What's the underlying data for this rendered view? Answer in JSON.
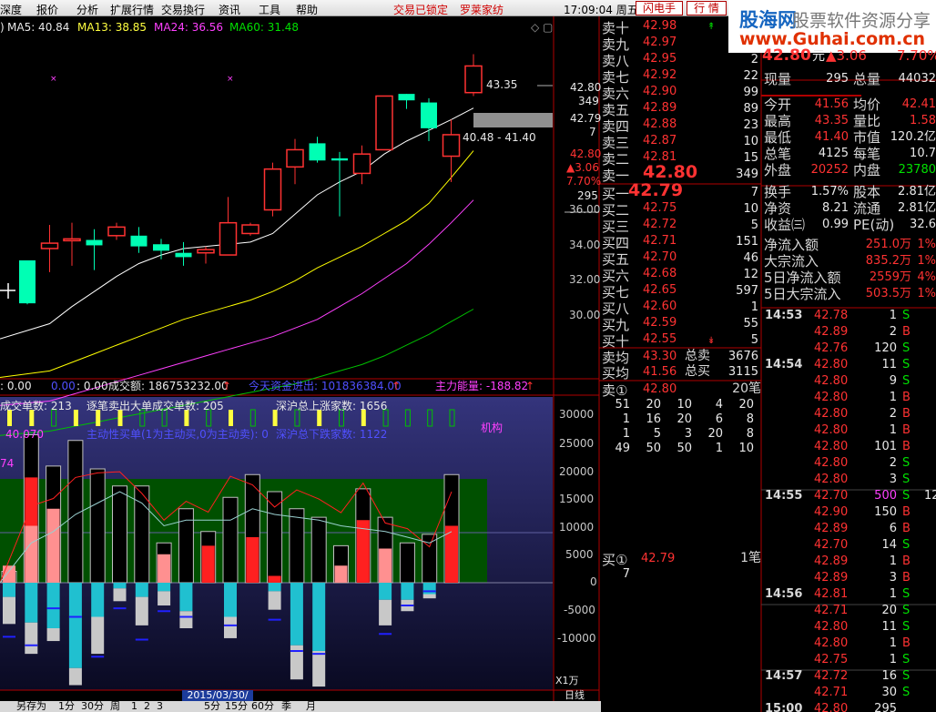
{
  "menu": [
    "深度",
    "报价",
    "分析",
    "扩展行情",
    "交易換行",
    "资讯",
    "工具",
    "帮助"
  ],
  "menu_status": [
    "交易已锁定",
    "罗莱家纺"
  ],
  "clock": "17:09:04 周五",
  "buttons": {
    "flash": "闪电手",
    "market": "行 情"
  },
  "logo": {
    "name": "股海网",
    "tagline": "股票软件资源分享",
    "url": "www.Guhai.com.cn"
  },
  "colors": {
    "up": "#ff3232",
    "down": "#00ffff",
    "ma5": "#ffffff",
    "ma13": "#ffff00",
    "ma24": "#ff40ff",
    "ma60": "#00c000"
  },
  "ma_header": {
    "prefix": ")",
    "ma5": "MA5: 40.84",
    "ma13": "MA13: 38.85",
    "ma24": "MA24: 36.56",
    "ma60": "MA60: 31.48"
  },
  "annotations": {
    "high": "43.35",
    "range": "40.48 - 41.40"
  },
  "price_axis": {
    "ticks": [
      "36.00",
      "34.00",
      "32.00",
      "30.00"
    ],
    "quote": [
      "42.80",
      "349",
      "42.79",
      "7",
      "42.80",
      "▲3.06",
      "7.70%",
      "295"
    ]
  },
  "indicator_header": {
    "a": ": 0.00",
    "b": "0.00",
    "c": ": 0.00",
    "d": "成交额: 186753232.00",
    "e": "今天资金进出: 101836384.00",
    "f": "主力能量: -188.82"
  },
  "indicator_texts": {
    "l1a": "成交单数: 213",
    "l1b": "逐笔卖出大单成交单数: 205",
    "l1c": "深沪总上涨家数: 1656",
    "l2a": "40.070",
    "l2b": "主动性买单(1为主动买,0为主动卖): 0",
    "l2c": "深沪总下跌家数: 1122",
    "l3": "74",
    "jigou": "机构"
  },
  "ind_axis": [
    "30000",
    "25000",
    "20000",
    "15000",
    "10000",
    "5000",
    "0",
    "-5000",
    "-10000"
  ],
  "unit_label": "X1万",
  "daily_label": "日线",
  "date_label": "2015/03/30/一",
  "bottom_tabs": [
    "另存为",
    "1分",
    "30分",
    "周",
    "1",
    "2",
    "3",
    "5分",
    "15分",
    "60分",
    "季",
    "月"
  ],
  "order_book": {
    "asks": [
      {
        "label": "卖十",
        "price": "42.98",
        "vol": ""
      },
      {
        "label": "卖九",
        "price": "42.97",
        "vol": ""
      },
      {
        "label": "卖八",
        "price": "42.95",
        "vol": "2"
      },
      {
        "label": "卖七",
        "price": "42.92",
        "vol": "22"
      },
      {
        "label": "卖六",
        "price": "42.90",
        "vol": "99"
      },
      {
        "label": "卖五",
        "price": "42.89",
        "vol": "89"
      },
      {
        "label": "卖四",
        "price": "42.88",
        "vol": "23"
      },
      {
        "label": "卖三",
        "price": "42.87",
        "vol": "10"
      },
      {
        "label": "卖二",
        "price": "42.81",
        "vol": "15"
      },
      {
        "label": "卖一",
        "price": "42.80",
        "vol": "349"
      }
    ],
    "bids": [
      {
        "label": "买一",
        "price": "42.79",
        "vol": "7"
      },
      {
        "label": "买二",
        "price": "42.75",
        "vol": "10"
      },
      {
        "label": "买三",
        "price": "42.72",
        "vol": "5"
      },
      {
        "label": "买四",
        "price": "42.71",
        "vol": "151"
      },
      {
        "label": "买五",
        "price": "42.70",
        "vol": "46"
      },
      {
        "label": "买六",
        "price": "42.68",
        "vol": "12"
      },
      {
        "label": "买七",
        "price": "42.65",
        "vol": "597"
      },
      {
        "label": "买八",
        "price": "42.60",
        "vol": "1"
      },
      {
        "label": "买九",
        "price": "42.59",
        "vol": "55"
      },
      {
        "label": "买十",
        "price": "42.55",
        "vol": "5"
      }
    ],
    "avg_rows": [
      {
        "label": "卖均",
        "price": "43.30",
        "name": "总卖",
        "vol": "3676"
      },
      {
        "label": "买均",
        "price": "41.56",
        "name": "总买",
        "vol": "3115"
      }
    ],
    "sell1_queue": {
      "label": "卖①",
      "price": "42.80",
      "count": "20笔",
      "rows": [
        [
          "51",
          "20",
          "10",
          "4",
          "20"
        ],
        [
          "1",
          "16",
          "20",
          "6",
          "8"
        ],
        [
          "1",
          "5",
          "3",
          "20",
          "8"
        ],
        [
          "49",
          "50",
          "50",
          "1",
          "10"
        ]
      ]
    },
    "buy1_queue": {
      "label": "买①",
      "price": "42.79",
      "count": "1笔",
      "rows": [
        [
          "7"
        ]
      ]
    }
  },
  "quote_panel": {
    "top": {
      "price": "42.80",
      "unit": "元",
      "change": "▲3.06",
      "pct": "7.70%"
    },
    "rows": [
      [
        "现量",
        "295",
        "总量",
        "44032"
      ],
      [
        "今开",
        "41.56",
        "均价",
        "42.41"
      ],
      [
        "最高",
        "43.35",
        "量比",
        "1.58"
      ],
      [
        "最低",
        "41.40",
        "市值",
        "120.2亿"
      ],
      [
        "总笔",
        "4125",
        "每笔",
        "10.7"
      ],
      [
        "外盘",
        "20252",
        "内盘",
        "23780"
      ],
      [
        "换手",
        "1.57%",
        "股本",
        "2.81亿"
      ],
      [
        "净资",
        "8.21",
        "流通",
        "2.81亿"
      ],
      [
        "收益㈢",
        "0.99",
        "PE(动)",
        "32.6"
      ],
      [
        "净流入额",
        "",
        "251.0万",
        "1%"
      ],
      [
        "大宗流入",
        "",
        "835.2万",
        "1%"
      ],
      [
        "5日净流入额",
        "",
        "2559万",
        "4%"
      ],
      [
        "5日大宗流入",
        "",
        "503.5万",
        "1%"
      ]
    ]
  },
  "ticks": [
    {
      "time": "14:53",
      "price": "42.78",
      "vol": "1",
      "bs": "S"
    },
    {
      "time": "",
      "price": "42.89",
      "vol": "2",
      "bs": "B"
    },
    {
      "time": "",
      "price": "42.76",
      "vol": "120",
      "bs": "S"
    },
    {
      "time": "14:54",
      "price": "42.80",
      "vol": "11",
      "bs": "S"
    },
    {
      "time": "",
      "price": "42.80",
      "vol": "9",
      "bs": "S"
    },
    {
      "time": "",
      "price": "42.80",
      "vol": "1",
      "bs": "B"
    },
    {
      "time": "",
      "price": "42.80",
      "vol": "2",
      "bs": "B"
    },
    {
      "time": "",
      "price": "42.80",
      "vol": "1",
      "bs": "B"
    },
    {
      "time": "",
      "price": "42.80",
      "vol": "101",
      "bs": "B"
    },
    {
      "time": "",
      "price": "42.80",
      "vol": "2",
      "bs": "S"
    },
    {
      "time": "",
      "price": "42.80",
      "vol": "3",
      "bs": "S"
    },
    {
      "time": "14:55",
      "price": "42.70",
      "vol": "500",
      "bs": "S",
      "extra": "12"
    },
    {
      "time": "",
      "price": "42.90",
      "vol": "150",
      "bs": "B"
    },
    {
      "time": "",
      "price": "42.89",
      "vol": "6",
      "bs": "B"
    },
    {
      "time": "",
      "price": "42.70",
      "vol": "14",
      "bs": "S"
    },
    {
      "time": "",
      "price": "42.89",
      "vol": "1",
      "bs": "B"
    },
    {
      "time": "",
      "price": "42.89",
      "vol": "3",
      "bs": "B"
    },
    {
      "time": "14:56",
      "price": "42.81",
      "vol": "1",
      "bs": "S"
    },
    {
      "time": "",
      "price": "42.71",
      "vol": "20",
      "bs": "S"
    },
    {
      "time": "",
      "price": "42.80",
      "vol": "11",
      "bs": "S"
    },
    {
      "time": "",
      "price": "42.80",
      "vol": "1",
      "bs": "B"
    },
    {
      "time": "",
      "price": "42.75",
      "vol": "1",
      "bs": "S"
    },
    {
      "time": "14:57",
      "price": "42.72",
      "vol": "16",
      "bs": "S"
    },
    {
      "time": "",
      "price": "42.71",
      "vol": "30",
      "bs": "S"
    },
    {
      "time": "15:00",
      "price": "42.80",
      "vol": "295",
      "bs": ""
    }
  ],
  "chart_data": [
    {
      "type": "candlestick",
      "title": "",
      "ylabel": "",
      "ylim": [
        29,
        44.6
      ],
      "series": [
        {
          "name": "K",
          "values": [
            {
              "o": 33.75,
              "c": 31.75,
              "h": 33.75,
              "l": 31.7
            },
            {
              "o": 34.3,
              "c": 34.55,
              "h": 35.4,
              "l": 33.2
            },
            {
              "o": 34.7,
              "c": 34.75,
              "h": 35.5,
              "l": 33.5
            },
            {
              "o": 34.7,
              "c": 34.45,
              "h": 35.2,
              "l": 33.3
            },
            {
              "o": 34.9,
              "c": 35.3,
              "h": 35.5,
              "l": 34.7
            },
            {
              "o": 34.9,
              "c": 34.4,
              "h": 35.3,
              "l": 34.1
            },
            {
              "o": 34.5,
              "c": 34.2,
              "h": 34.75,
              "l": 33.8
            },
            {
              "o": 34.1,
              "c": 33.9,
              "h": 34.6,
              "l": 33.5
            },
            {
              "o": 34.1,
              "c": 34.25,
              "h": 34.4,
              "l": 33.6
            },
            {
              "o": 34.0,
              "c": 35.5,
              "h": 36.7,
              "l": 34.0
            },
            {
              "o": 35.0,
              "c": 35.4,
              "h": 35.5,
              "l": 34.9
            },
            {
              "o": 36.1,
              "c": 38.0,
              "h": 38.3,
              "l": 35.8
            },
            {
              "o": 38.1,
              "c": 38.9,
              "h": 39.4,
              "l": 37.3
            },
            {
              "o": 39.2,
              "c": 38.4,
              "h": 39.5,
              "l": 38.3
            },
            {
              "o": 38.5,
              "c": 38.4,
              "h": 38.8,
              "l": 35.8
            },
            {
              "o": 37.8,
              "c": 38.7,
              "h": 39.1,
              "l": 37.3
            },
            {
              "o": 38.9,
              "c": 41.4,
              "h": 41.4,
              "l": 38.9
            },
            {
              "o": 41.5,
              "c": 41.2,
              "h": 41.5,
              "l": 40.8
            },
            {
              "o": 41.1,
              "c": 39.9,
              "h": 41.3,
              "l": 39.3
            },
            {
              "o": 38.6,
              "c": 39.6,
              "h": 40.3,
              "l": 37.4
            },
            {
              "o": 41.56,
              "c": 42.8,
              "h": 43.35,
              "l": 41.4
            }
          ]
        },
        {
          "name": "MA5",
          "values": [
            30.1,
            30.8,
            31.6,
            32.3,
            33.0,
            33.6,
            34.0,
            34.3,
            34.4,
            34.5,
            34.6,
            35.0,
            35.9,
            36.8,
            37.4,
            37.9,
            38.7,
            39.3,
            39.8,
            40.3,
            40.84
          ]
        },
        {
          "name": "MA13",
          "values": [
            28.3,
            28.6,
            29.0,
            29.4,
            29.8,
            30.2,
            30.6,
            31.0,
            31.3,
            31.6,
            31.9,
            32.3,
            32.8,
            33.4,
            33.9,
            34.4,
            35.0,
            35.6,
            36.4,
            37.6,
            38.85
          ]
        },
        {
          "name": "MA24",
          "values": [
            27.0,
            27.2,
            27.5,
            27.8,
            28.1,
            28.4,
            28.7,
            29.0,
            29.3,
            29.6,
            29.9,
            30.2,
            30.6,
            31.0,
            31.6,
            32.2,
            32.9,
            33.6,
            34.5,
            35.5,
            36.56
          ]
        },
        {
          "name": "MA60",
          "values": [
            25.6,
            25.8,
            26.0,
            26.2,
            26.4,
            26.6,
            26.8,
            27.0,
            27.2,
            27.4,
            27.6,
            27.8,
            28.0,
            28.3,
            28.6,
            28.9,
            29.3,
            29.8,
            30.3,
            30.9,
            31.48
          ]
        }
      ]
    },
    {
      "type": "bar",
      "title": "",
      "ylim": [
        -18500,
        32000
      ],
      "series": [
        {
          "name": "black",
          "values": [
            2000,
            26000,
            20500,
            25000,
            20000,
            17000,
            17000,
            7000,
            13000,
            9000,
            15000,
            19000,
            16000,
            13000,
            11500,
            6500,
            16500,
            11500,
            7000,
            8500,
            19000
          ]
        },
        {
          "name": "red",
          "values": [
            0,
            18500,
            0,
            0,
            0,
            0,
            0,
            0,
            0,
            6500,
            0,
            8000,
            1200,
            0,
            0,
            2000,
            11000,
            0,
            0,
            0,
            10000
          ]
        },
        {
          "name": "pink",
          "values": [
            3000,
            10000,
            13000,
            0,
            0,
            0,
            0,
            5000,
            0,
            0,
            0,
            0,
            0,
            0,
            0,
            3000,
            0,
            6000,
            0,
            0,
            0
          ]
        },
        {
          "name": "cyan",
          "values": [
            -2500,
            -7000,
            -8000,
            -15000,
            -6000,
            -1000,
            -2500,
            -1500,
            -5000,
            0,
            -6000,
            0,
            -1500,
            -11000,
            -12000,
            0,
            0,
            -3000,
            -3000,
            -2000,
            0
          ]
        },
        {
          "name": "gray",
          "values": [
            -9500,
            -11000,
            -4500,
            -6000,
            -13000,
            -4500,
            -10000,
            -5000,
            -6000,
            0,
            -7500,
            0,
            -6500,
            -12000,
            -12500,
            0,
            0,
            -9000,
            -4000,
            -1500,
            0
          ]
        },
        {
          "name": "line_red",
          "values": [
            0,
            13500,
            14800,
            18500,
            19300,
            19500,
            15700,
            11000,
            14300,
            12400,
            18700,
            17200,
            13300,
            16300,
            14700,
            12300,
            17500,
            10500,
            9500,
            6300,
            16000
          ]
        },
        {
          "name": "line_white",
          "values": [
            0,
            7000,
            9000,
            12000,
            14000,
            16000,
            14000,
            10000,
            11000,
            11000,
            11000,
            13000,
            12000,
            11500,
            11000,
            10000,
            9500,
            9000,
            8000,
            7000,
            9000
          ]
        }
      ]
    }
  ]
}
